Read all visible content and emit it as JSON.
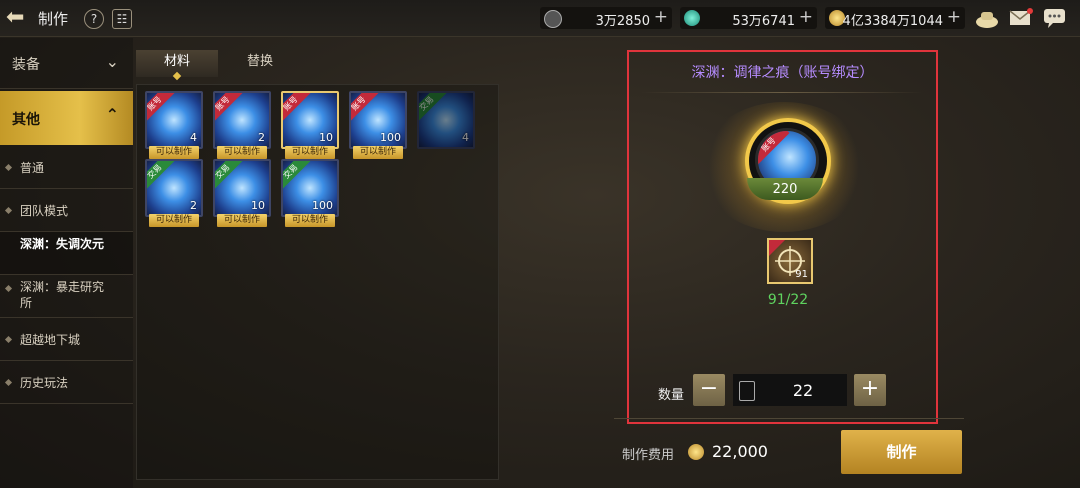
{
  "header": {
    "title": "制作"
  },
  "resources": [
    {
      "icon": "c-coin-icon",
      "value": "3万2850"
    },
    {
      "icon": "crystal-icon",
      "value": "53万6741"
    },
    {
      "icon": "gold-coin-icon",
      "value": "4亿3384万1044"
    }
  ],
  "menu": {
    "equip": "装备",
    "other": "其他",
    "items": [
      "普通",
      "团队模式",
      "深渊：失调次元",
      "深渊：暴走研究所",
      "超越地下城",
      "历史玩法"
    ]
  },
  "tabs": [
    "材料",
    "替换"
  ],
  "grid": {
    "items": [
      {
        "tag": "账号",
        "count": "4",
        "status": "可以制作"
      },
      {
        "tag": "账号",
        "count": "2",
        "status": "可以制作"
      },
      {
        "tag": "账号",
        "count": "10",
        "status": "可以制作"
      },
      {
        "tag": "账号",
        "count": "100",
        "status": "可以制作"
      },
      {
        "tag": "交易",
        "count": "4",
        "status": ""
      },
      {
        "tag": "交易",
        "count": "2",
        "status": "可以制作"
      },
      {
        "tag": "交易",
        "count": "10",
        "status": "可以制作"
      },
      {
        "tag": "交易",
        "count": "100",
        "status": "可以制作"
      }
    ]
  },
  "detail": {
    "title": "深渊：调律之痕（账号绑定）",
    "result_tag": "账号",
    "result_count": "220",
    "material_tag": "账号",
    "material_count": "91",
    "material_req": "91/22",
    "qty_label": "数量",
    "qty_value": "22",
    "minus": "−",
    "plus": "+"
  },
  "footer": {
    "cost_label": "制作费用",
    "cost_value": "22,000",
    "make": "制作"
  },
  "colors": {
    "accent_gold": "#e5c04a",
    "highlight_red": "#e0343c",
    "title_purple": "#b68cff",
    "ok_green": "#5fd35f"
  }
}
